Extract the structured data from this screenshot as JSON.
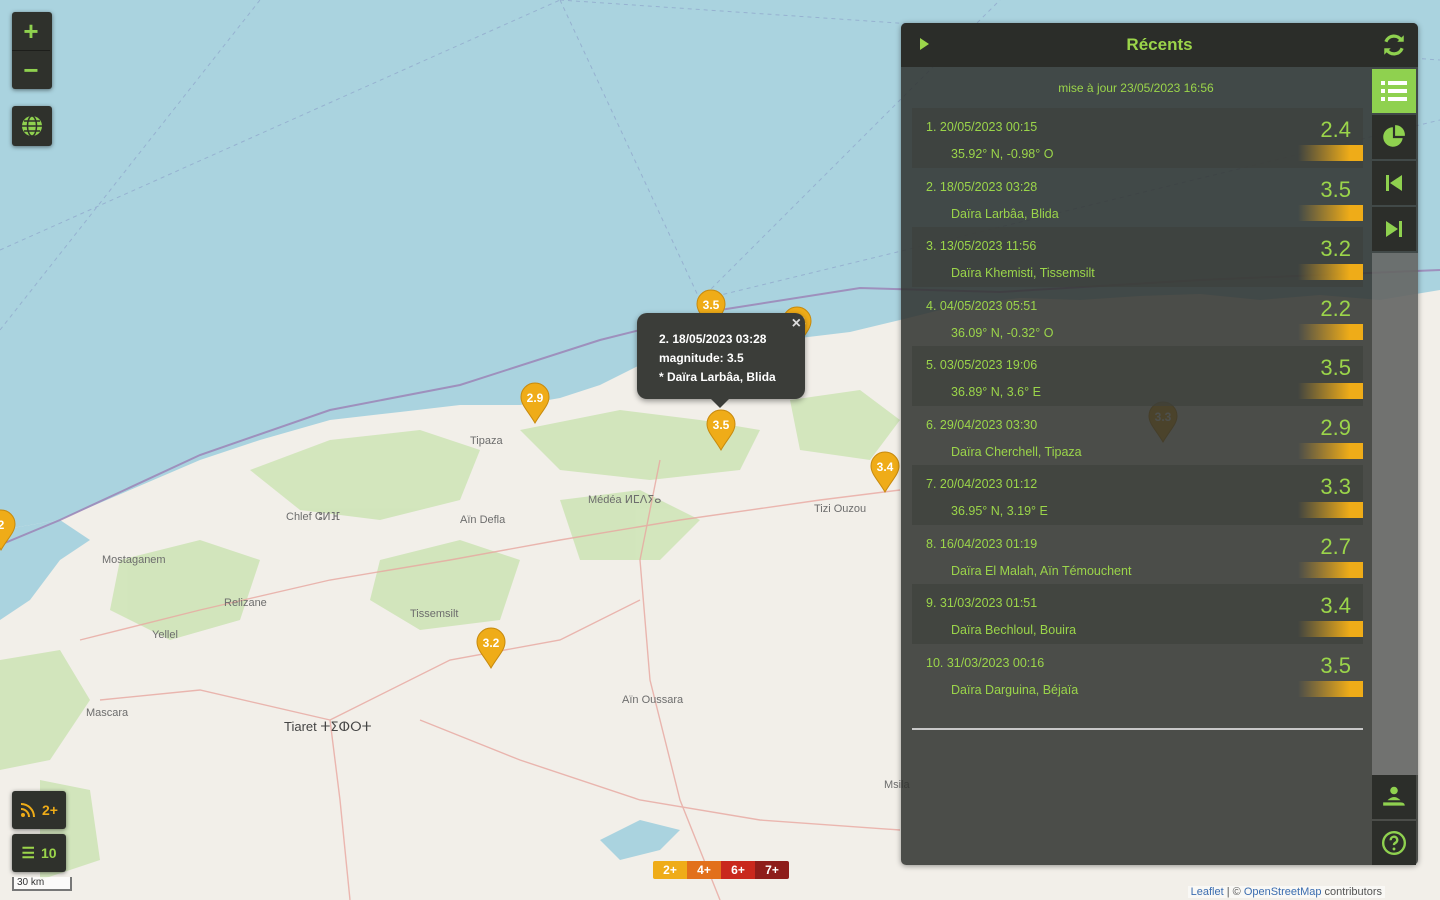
{
  "colors": {
    "accent": "#9bd54a",
    "marker": "#efac18",
    "panel": "#30322e"
  },
  "zoom": {
    "in_icon": "plus-icon",
    "out_icon": "minus-icon"
  },
  "map_labels": [
    {
      "text": "Médéa ⵍⵎⴷⵢⴰ"
    },
    {
      "text": "Chlef ⵛⵍⴼ"
    },
    {
      "text": "Aïn Defla"
    },
    {
      "text": "Mostaganem"
    },
    {
      "text": "Relizane"
    },
    {
      "text": "Yellel"
    },
    {
      "text": "Tissemsilt"
    },
    {
      "text": "Tiaret ⵜⵉⵀⵔⵜ"
    },
    {
      "text": "Mascara"
    },
    {
      "text": "Aïn Oussara"
    },
    {
      "text": "Tizi Ouzou"
    },
    {
      "text": "Tipaza"
    },
    {
      "text": "Msila"
    }
  ],
  "markers": [
    {
      "label": "3.5"
    },
    {
      "label": "2.4"
    },
    {
      "label": "2.9"
    },
    {
      "label": "3.5"
    },
    {
      "label": "3.4"
    },
    {
      "label": "3.2"
    },
    {
      "label": "2"
    },
    {
      "label": "3.3"
    }
  ],
  "popup": {
    "line1": "2. 18/05/2023 03:28",
    "line2": "magnitude: 3.5",
    "line3": "* Daïra Larbâa, Blida",
    "close": "×"
  },
  "bottom_left": {
    "feed_label": "2+",
    "list_label": "10",
    "scale": "30 km"
  },
  "legend": [
    "2+",
    "4+",
    "6+",
    "7+"
  ],
  "attribution": {
    "leaflet": "Leaflet",
    "sep": " | © ",
    "osm": "OpenStreetMap",
    "rest": " contributors"
  },
  "panel": {
    "title": "Récents",
    "updated": "mise à jour 23/05/2023 16:56",
    "items": [
      {
        "line1": "1.  20/05/2023 00:15",
        "line2": "35.92° N, -0.98° O",
        "mag": "2.4"
      },
      {
        "line1": "2.  18/05/2023 03:28",
        "line2": "Daïra Larbâa, Blida",
        "mag": "3.5"
      },
      {
        "line1": "3.  13/05/2023 11:56",
        "line2": "Daïra Khemisti, Tissemsilt",
        "mag": "3.2"
      },
      {
        "line1": "4.  04/05/2023 05:51",
        "line2": "36.09° N, -0.32° O",
        "mag": "2.2"
      },
      {
        "line1": "5.  03/05/2023 19:06",
        "line2": "36.89° N, 3.6° E",
        "mag": "3.5"
      },
      {
        "line1": "6.  29/04/2023 03:30",
        "line2": "Daïra Cherchell, Tipaza",
        "mag": "2.9"
      },
      {
        "line1": "7.  20/04/2023 01:12",
        "line2": "36.95° N, 3.19° E",
        "mag": "3.3"
      },
      {
        "line1": "8.  16/04/2023 01:19",
        "line2": "Daïra El Malah, Aïn Témouchent",
        "mag": "2.7"
      },
      {
        "line1": "9.  31/03/2023 01:51",
        "line2": "Daïra Bechloul, Bouira",
        "mag": "3.4"
      },
      {
        "line1": "10.  31/03/2023 00:16",
        "line2": "Daïra Darguina, Béjaïa",
        "mag": "3.5"
      }
    ]
  }
}
